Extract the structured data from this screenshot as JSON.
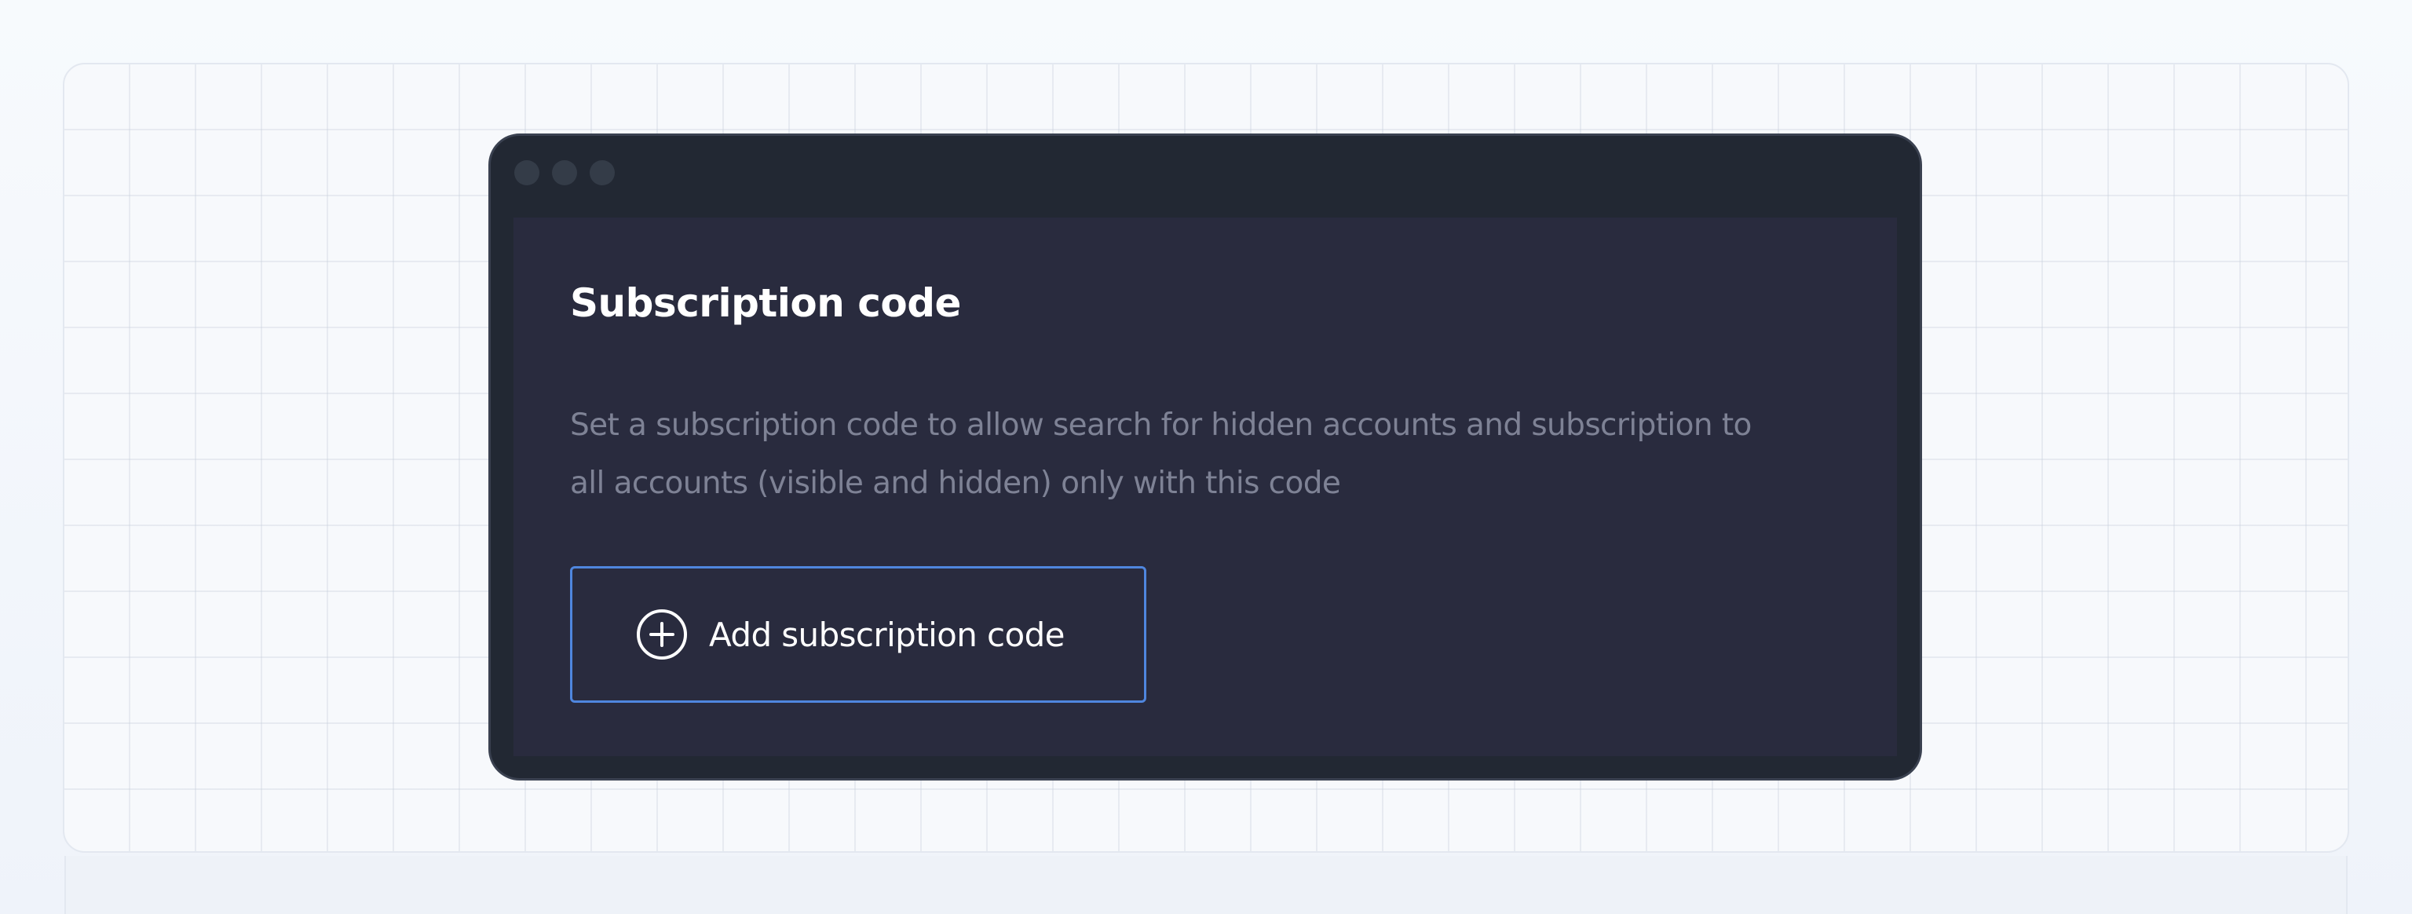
{
  "card": {
    "title": "Subscription code",
    "description": "Set a subscription code to allow search for hidden accounts and subscription to all accounts (visible and hidden) only with this code",
    "add_button": {
      "label": "Add subscription code",
      "icon": "plus-circle-icon"
    }
  },
  "window": {
    "controls": [
      "window-dot-icon",
      "window-dot-icon",
      "window-dot-icon"
    ]
  },
  "colors": {
    "page_background": "#f4f7fb",
    "window_frame": "#222833",
    "card_background": "#292b3e",
    "title_text": "#ffffff",
    "description_text": "#7e8295",
    "button_border": "#4f86de",
    "button_text": "#ffffff"
  }
}
